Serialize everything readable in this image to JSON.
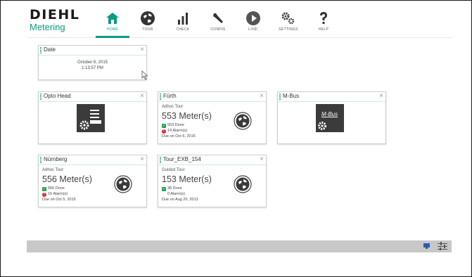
{
  "app": {
    "brand": "DIEHL",
    "sub_brand": "Metering",
    "accent_color": "#0a9a86"
  },
  "nav": [
    {
      "label": "HOME",
      "icon": "home-icon",
      "active": true
    },
    {
      "label": "TOUR",
      "icon": "globe-icon",
      "active": false
    },
    {
      "label": "CHECK",
      "icon": "bar-chart-icon",
      "active": false
    },
    {
      "label": "CONFIG",
      "icon": "wrench-icon",
      "active": false
    },
    {
      "label": "LIVE!",
      "icon": "play-icon",
      "active": false
    },
    {
      "label": "SETTINGS",
      "icon": "gears-icon",
      "active": false
    },
    {
      "label": "HELP",
      "icon": "question-icon",
      "active": false
    }
  ],
  "widgets": {
    "date": {
      "title": "Date",
      "date": "October 6, 2015",
      "time": "1:13:57 PM",
      "close": "×"
    },
    "opto": {
      "title": "Opto Head",
      "close": "×",
      "icon": "opto-head-icon"
    },
    "fuerth": {
      "title": "Fürth",
      "type": "Adhoc Tour",
      "meters": "553 Meter(s)",
      "done": "553 Done",
      "alarms": "14 Alarm(s)",
      "due": "Due on Oct 6, 2015",
      "close": "×"
    },
    "mbus": {
      "title": "M-Bus",
      "close": "×",
      "icon_text": "M-Bus"
    },
    "nuernberg": {
      "title": "Nürnberg",
      "type": "Adhoc Tour",
      "meters": "556 Meter(s)",
      "done": "556 Done",
      "alarms": "16 Alarm(s)",
      "due": "Due on Oct 5, 2015",
      "close": "×"
    },
    "exb": {
      "title": "Tour_EXB_154",
      "type": "Guided Tour",
      "meters": "153 Meter(s)",
      "done": "38 Done",
      "alarms": "0 Alarm(s)",
      "due": "Due on Aug 20, 2013",
      "close": "×"
    }
  },
  "statusbar": {
    "icons": [
      "monitor-icon",
      "sliders-icon"
    ]
  }
}
